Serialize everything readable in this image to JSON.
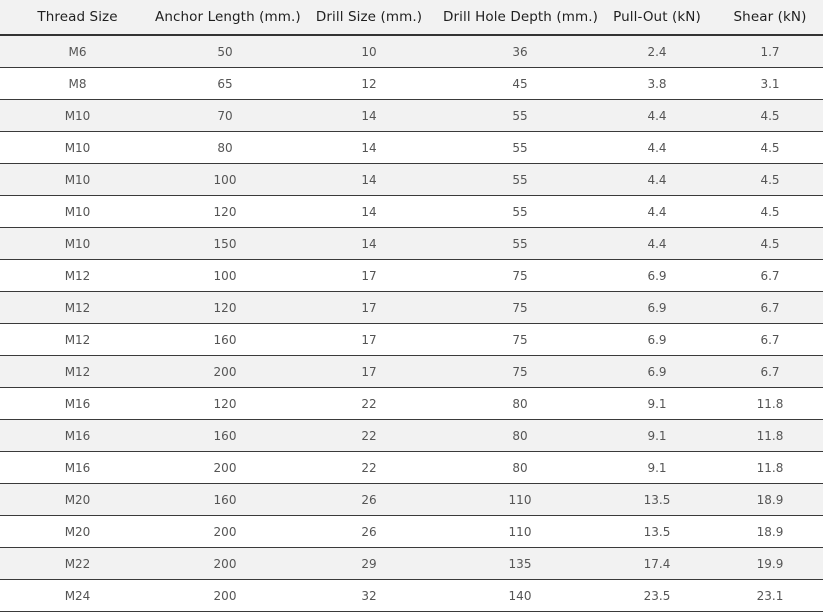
{
  "table": {
    "columns": [
      "Thread Size",
      "Anchor Length (mm.)",
      "Drill Size (mm.)",
      "Drill Hole Depth (mm.)",
      "Pull-Out (kN)",
      "Shear (kN)"
    ],
    "rows": [
      [
        "M6",
        "50",
        "10",
        "36",
        "2.4",
        "1.7"
      ],
      [
        "M8",
        "65",
        "12",
        "45",
        "3.8",
        "3.1"
      ],
      [
        "M10",
        "70",
        "14",
        "55",
        "4.4",
        "4.5"
      ],
      [
        "M10",
        "80",
        "14",
        "55",
        "4.4",
        "4.5"
      ],
      [
        "M10",
        "100",
        "14",
        "55",
        "4.4",
        "4.5"
      ],
      [
        "M10",
        "120",
        "14",
        "55",
        "4.4",
        "4.5"
      ],
      [
        "M10",
        "150",
        "14",
        "55",
        "4.4",
        "4.5"
      ],
      [
        "M12",
        "100",
        "17",
        "75",
        "6.9",
        "6.7"
      ],
      [
        "M12",
        "120",
        "17",
        "75",
        "6.9",
        "6.7"
      ],
      [
        "M12",
        "160",
        "17",
        "75",
        "6.9",
        "6.7"
      ],
      [
        "M12",
        "200",
        "17",
        "75",
        "6.9",
        "6.7"
      ],
      [
        "M16",
        "120",
        "22",
        "80",
        "9.1",
        "11.8"
      ],
      [
        "M16",
        "160",
        "22",
        "80",
        "9.1",
        "11.8"
      ],
      [
        "M16",
        "200",
        "22",
        "80",
        "9.1",
        "11.8"
      ],
      [
        "M20",
        "160",
        "26",
        "110",
        "13.5",
        "18.9"
      ],
      [
        "M20",
        "200",
        "26",
        "110",
        "13.5",
        "18.9"
      ],
      [
        "M22",
        "200",
        "29",
        "135",
        "17.4",
        "19.9"
      ],
      [
        "M24",
        "200",
        "32",
        "140",
        "23.5",
        "23.1"
      ]
    ]
  },
  "colors": {
    "header_background": "#f2f2f2",
    "header_text": "#1f1f1f",
    "row_alt_background": "#f2f2f2",
    "row_background": "#ffffff",
    "cell_text": "#555555",
    "border": "#3a3a3a",
    "header_border": "#333333"
  }
}
